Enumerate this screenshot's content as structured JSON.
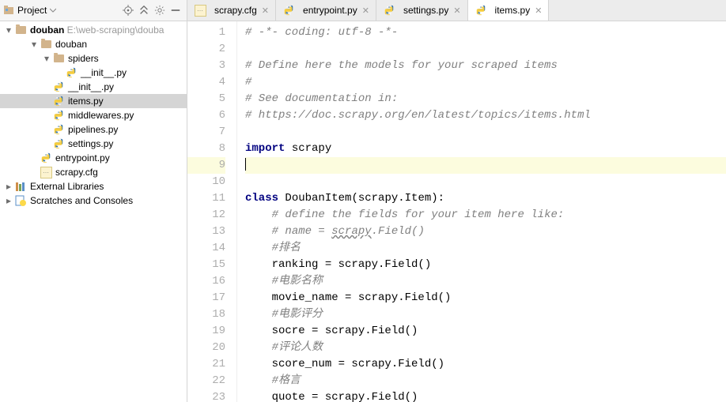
{
  "project_panel": {
    "title": "Project"
  },
  "tree": {
    "root": {
      "name": "douban",
      "path": "E:\\web-scraping\\douba"
    },
    "items": [
      {
        "name": "douban",
        "indent": 2,
        "type": "folder",
        "open": true
      },
      {
        "name": "spiders",
        "indent": 3,
        "type": "folder",
        "open": true
      },
      {
        "name": "__init__.py",
        "indent": 4,
        "type": "py"
      },
      {
        "name": "__init__.py",
        "indent": 3,
        "type": "py"
      },
      {
        "name": "items.py",
        "indent": 3,
        "type": "py",
        "selected": true
      },
      {
        "name": "middlewares.py",
        "indent": 3,
        "type": "py"
      },
      {
        "name": "pipelines.py",
        "indent": 3,
        "type": "py"
      },
      {
        "name": "settings.py",
        "indent": 3,
        "type": "py"
      },
      {
        "name": "entrypoint.py",
        "indent": 2,
        "type": "py"
      },
      {
        "name": "scrapy.cfg",
        "indent": 2,
        "type": "cfg"
      }
    ],
    "external": "External Libraries",
    "scratches": "Scratches and Consoles"
  },
  "tabs": [
    {
      "name": "scrapy.cfg",
      "type": "cfg"
    },
    {
      "name": "entrypoint.py",
      "type": "py"
    },
    {
      "name": "settings.py",
      "type": "py"
    },
    {
      "name": "items.py",
      "type": "py",
      "active": true
    }
  ],
  "code": {
    "lines": [
      {
        "n": 1,
        "html": "<span class='cm'># -*- coding: utf-8 -*-</span>"
      },
      {
        "n": 2,
        "html": ""
      },
      {
        "n": 3,
        "html": "<span class='cm'># Define here the models for your scraped items</span>"
      },
      {
        "n": 4,
        "html": "<span class='cm'>#</span>"
      },
      {
        "n": 5,
        "html": "<span class='cm'># See documentation in:</span>"
      },
      {
        "n": 6,
        "html": "<span class='cm'># https://doc.scrapy.org/en/latest/topics/items.html</span>"
      },
      {
        "n": 7,
        "html": ""
      },
      {
        "n": 8,
        "html": "<span class='kw'>import</span> scrapy"
      },
      {
        "n": 9,
        "html": "<span class='caret'></span>",
        "hl": true
      },
      {
        "n": 10,
        "html": ""
      },
      {
        "n": 11,
        "html": "<span class='kw'>class</span> <span class='fn'>DoubanItem</span>(scrapy.Item):"
      },
      {
        "n": 12,
        "html": "    <span class='cm'># define the fields for your item here like:</span>"
      },
      {
        "n": 13,
        "html": "    <span class='cm'># name = <span class='und'>scrapy</span>.Field()</span>"
      },
      {
        "n": 14,
        "html": "    <span class='cm'>#排名</span>"
      },
      {
        "n": 15,
        "html": "    ranking = scrapy.Field()"
      },
      {
        "n": 16,
        "html": "    <span class='cm'>#电影名称</span>"
      },
      {
        "n": 17,
        "html": "    movie_name = scrapy.Field()"
      },
      {
        "n": 18,
        "html": "    <span class='cm'>#电影评分</span>"
      },
      {
        "n": 19,
        "html": "    socre = scrapy.Field()"
      },
      {
        "n": 20,
        "html": "    <span class='cm'>#评论人数</span>"
      },
      {
        "n": 21,
        "html": "    score_num = scrapy.Field()"
      },
      {
        "n": 22,
        "html": "    <span class='cm'>#格言</span>"
      },
      {
        "n": 23,
        "html": "    quote = scrapy.Field()"
      }
    ]
  }
}
